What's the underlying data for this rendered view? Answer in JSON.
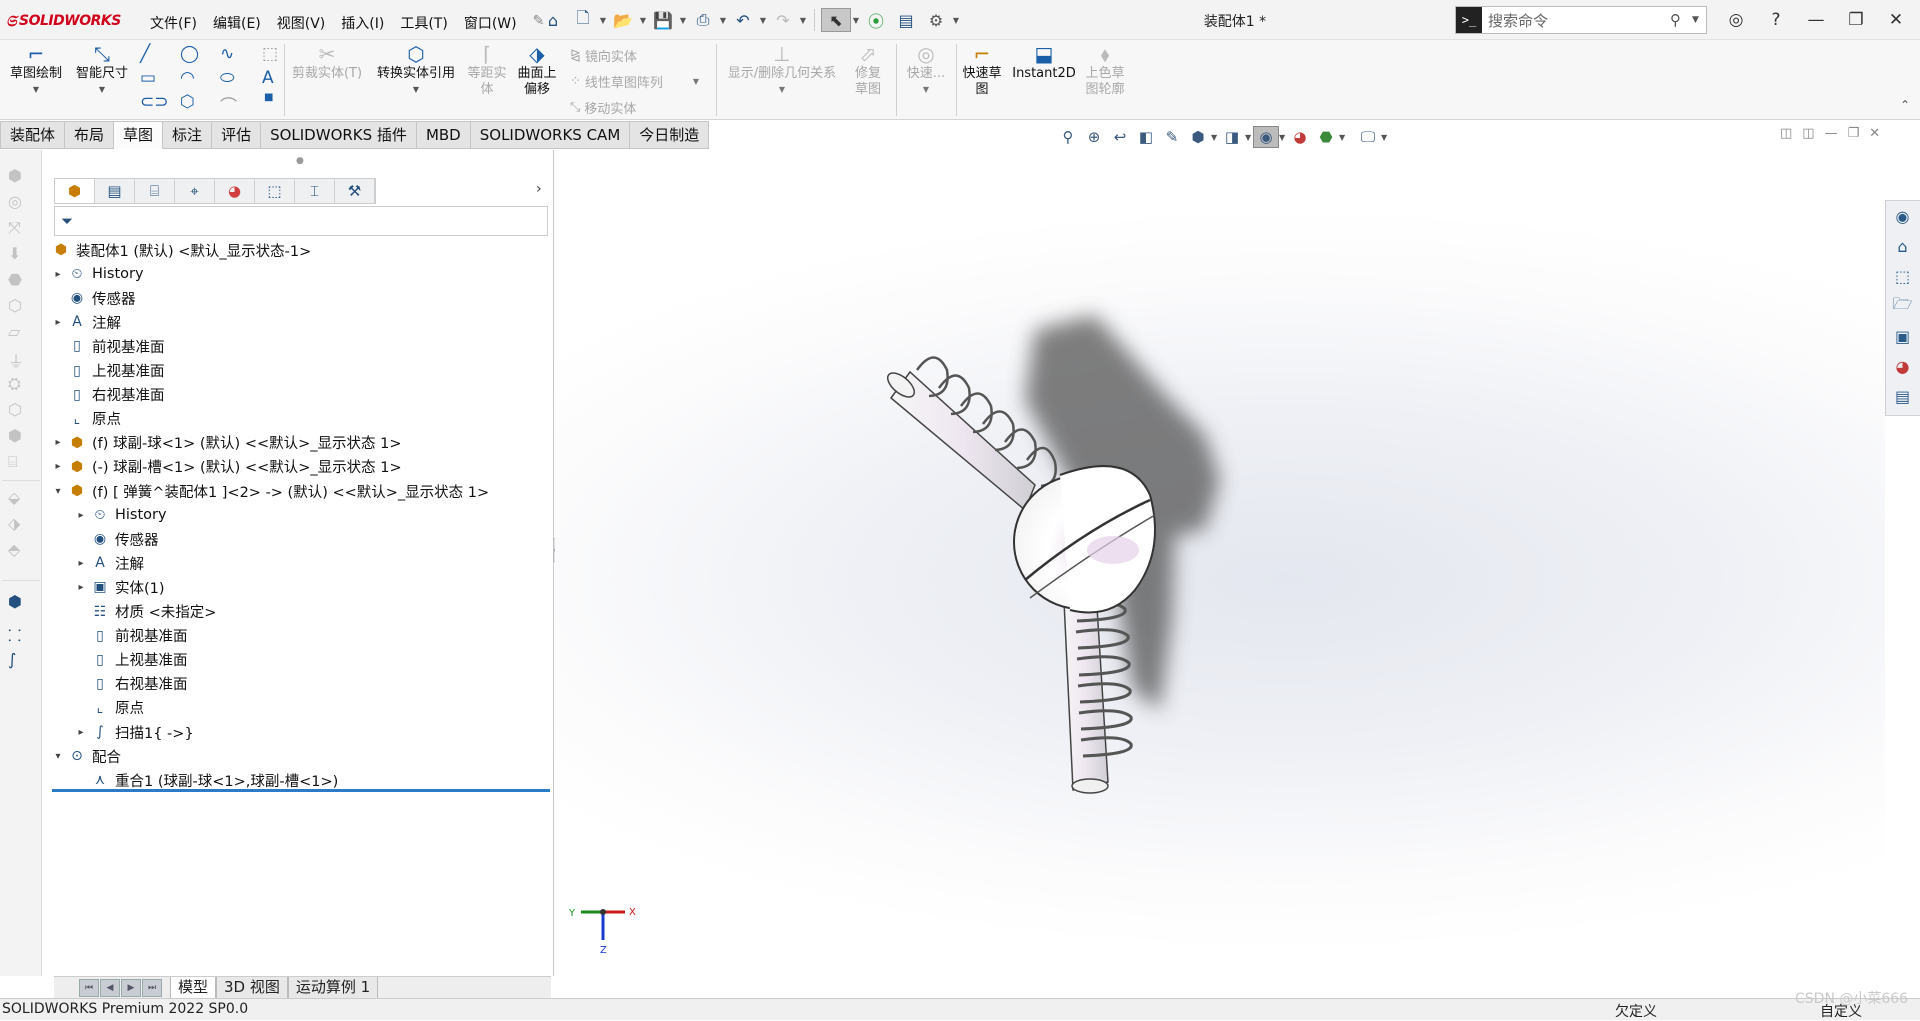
{
  "app": {
    "logo_text": "SOLIDWORKS",
    "document_title": "装配体1 *"
  },
  "menu": [
    "文件(F)",
    "编辑(E)",
    "视图(V)",
    "插入(I)",
    "工具(T)",
    "窗口(W)"
  ],
  "quick_access_icons": [
    "home-icon",
    "new-document-icon",
    "open-icon",
    "save-icon",
    "print-icon",
    "undo-icon",
    "redo-icon",
    "select-pointer-icon",
    "traffic-light-icon",
    "file-properties-icon",
    "options-gear-icon"
  ],
  "search": {
    "placeholder": "搜索命令"
  },
  "command_manager": {
    "sketch": "草图绘制",
    "smart_dimension": "智能尺寸",
    "trim": "剪裁实体(T)",
    "convert": "转换实体引用",
    "offset": "等距实体",
    "surface_offset": "曲面上偏移",
    "mirror": "镜向实体",
    "linear_pattern": "线性草图阵列",
    "move": "移动实体",
    "show_relations": "显示/删除几何关系",
    "repair": "修复草图",
    "quick_snaps": "快速...",
    "rapid_sketch": "快速草图",
    "instant2d": "Instant2D",
    "shaded_contours": "上色草图轮廓"
  },
  "tabs": [
    "装配体",
    "布局",
    "草图",
    "标注",
    "评估",
    "SOLIDWORKS 插件",
    "MBD",
    "SOLIDWORKS CAM",
    "今日制造"
  ],
  "active_tab": "草图",
  "tree": {
    "root": "装配体1 (默认) <默认_显示状态-1>",
    "items": [
      {
        "label": "History",
        "icon": "history-icon",
        "indent": 0,
        "expander": "▸"
      },
      {
        "label": "传感器",
        "icon": "sensor-icon",
        "indent": 0,
        "expander": ""
      },
      {
        "label": "注解",
        "icon": "annotation-icon",
        "indent": 0,
        "expander": "▸"
      },
      {
        "label": "前视基准面",
        "icon": "plane-icon",
        "indent": 0,
        "expander": ""
      },
      {
        "label": "上视基准面",
        "icon": "plane-icon",
        "indent": 0,
        "expander": ""
      },
      {
        "label": "右视基准面",
        "icon": "plane-icon",
        "indent": 0,
        "expander": ""
      },
      {
        "label": "原点",
        "icon": "origin-icon",
        "indent": 0,
        "expander": ""
      },
      {
        "label": "(f) 球副-球<1> (默认) <<默认>_显示状态 1>",
        "icon": "part-icon",
        "indent": 0,
        "expander": "▸"
      },
      {
        "label": "(-) 球副-槽<1> (默认) <<默认>_显示状态 1>",
        "icon": "part-icon",
        "indent": 0,
        "expander": "▸"
      },
      {
        "label": "(f) [ 弹簧^装配体1 ]<2> -> (默认) <<默认>_显示状态 1>",
        "icon": "virtual-part-icon",
        "indent": 0,
        "expander": "▾"
      },
      {
        "label": "History",
        "icon": "history-icon",
        "indent": 1,
        "expander": "▸"
      },
      {
        "label": "传感器",
        "icon": "sensor-icon",
        "indent": 1,
        "expander": ""
      },
      {
        "label": "注解",
        "icon": "annotation-icon",
        "indent": 1,
        "expander": "▸"
      },
      {
        "label": "实体(1)",
        "icon": "solid-body-icon",
        "indent": 1,
        "expander": "▸"
      },
      {
        "label": "材质 <未指定>",
        "icon": "material-icon",
        "indent": 1,
        "expander": ""
      },
      {
        "label": "前视基准面",
        "icon": "plane-icon",
        "indent": 1,
        "expander": ""
      },
      {
        "label": "上视基准面",
        "icon": "plane-icon",
        "indent": 1,
        "expander": ""
      },
      {
        "label": "右视基准面",
        "icon": "plane-icon",
        "indent": 1,
        "expander": ""
      },
      {
        "label": "原点",
        "icon": "origin-icon",
        "indent": 1,
        "expander": ""
      },
      {
        "label": "扫描1{ ->}",
        "icon": "sweep-icon",
        "indent": 1,
        "expander": "▸"
      },
      {
        "label": "配合",
        "icon": "mates-icon",
        "indent": 0,
        "expander": "▾"
      },
      {
        "label": "重合1 (球副-球<1>,球副-槽<1>)",
        "icon": "coincident-mate-icon",
        "indent": 1,
        "expander": ""
      }
    ]
  },
  "bottom_tabs": [
    "模型",
    "3D 视图",
    "运动算例 1"
  ],
  "triad": {
    "x": "X",
    "y": "Y",
    "z": "Z"
  },
  "status": {
    "left": "SOLIDWORKS Premium 2022 SP0.0",
    "middle": "欠定义",
    "right": "自定义"
  },
  "watermark": "CSDN @小菜666",
  "colors": {
    "accent": "#2b7bc7",
    "brand": "#d0021b"
  }
}
